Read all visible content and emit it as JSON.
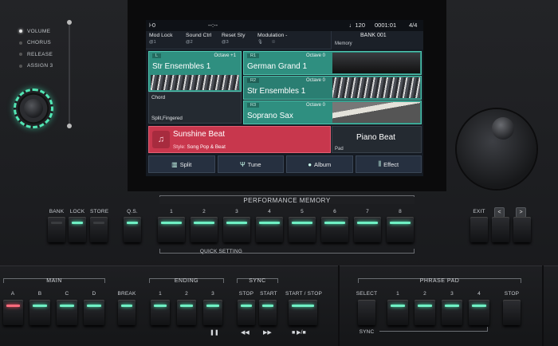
{
  "left_panel": {
    "knob_assign": [
      "VOLUME",
      "CHORUS",
      "RELEASE",
      "ASSIGN 3"
    ],
    "active_index": 0
  },
  "screen": {
    "status": {
      "left_icon": "⊦0",
      "center": "--:--",
      "tempo": "♩120",
      "measure": "0001:01",
      "beat": "4/4"
    },
    "params": [
      {
        "label": "Mod Lock",
        "value": "@1"
      },
      {
        "label": "Sound Ctrl",
        "value": "@2"
      },
      {
        "label": "Reset Sty",
        "value": "@3"
      },
      {
        "label": "Modulation",
        "value": "-"
      }
    ],
    "bank": {
      "title": "BANK 001",
      "memory": "Memory"
    },
    "parts": {
      "left": {
        "tag": "L",
        "octave": "Octave +1",
        "name": "Str Ensembles 1"
      },
      "r1": {
        "tag": "R1",
        "octave": "Octave 0",
        "name": "German Grand 1"
      },
      "r2": {
        "tag": "R2",
        "octave": "Octave 0",
        "name": "Str Ensembles 1"
      },
      "r3": {
        "tag": "R3",
        "octave": "Octave 0",
        "name": "Soprano Sax"
      }
    },
    "chord": {
      "label": "Chord",
      "mode": "Split,Fingered"
    },
    "style": {
      "name": "Sunshine Beat",
      "category_label": "Style:",
      "category": "Song Pop & Beat"
    },
    "pad": {
      "name": "Piano Beat",
      "label": "Pad"
    },
    "tabs": [
      {
        "icon": "▥",
        "label": "Split"
      },
      {
        "icon": "Ψ",
        "label": "Tune"
      },
      {
        "icon": "●",
        "label": "Album"
      },
      {
        "icon": "⫼",
        "label": "Effect"
      }
    ]
  },
  "upper_buttons": {
    "bank": "BANK",
    "lock": "LOCK",
    "store": "STORE",
    "qs": "Q.S.",
    "performance_memory": "PERFORMANCE MEMORY",
    "memory_numbers": [
      "1",
      "2",
      "3",
      "4",
      "5",
      "6",
      "7",
      "8"
    ],
    "quick_setting": "QUICK SETTING",
    "exit": "EXIT",
    "nav_left": "<",
    "nav_right": ">"
  },
  "lower_buttons": {
    "main": "MAIN",
    "main_variations": [
      "A",
      "B",
      "C",
      "D"
    ],
    "break": "BREAK",
    "ending": "ENDING",
    "ending_numbers": [
      "1",
      "2",
      "3"
    ],
    "sync": "SYNC",
    "stop": "STOP",
    "start": "START",
    "start_stop": "START / STOP",
    "phrase_pad": "PHRASE PAD",
    "select": "SELECT",
    "pad_numbers": [
      "1",
      "2",
      "3",
      "4"
    ],
    "pad_stop": "STOP",
    "pad_sync": "SYNC",
    "pause_sym": "❚❚",
    "rewind_sym": "◀◀",
    "ff_sym": "▶▶",
    "play_sym": "■ ▶/■"
  },
  "colors": {
    "led_green": "#6ff0c4",
    "led_red": "#ff6b7d",
    "style_red": "#c8374d",
    "part_teal": "#2f8f80"
  }
}
